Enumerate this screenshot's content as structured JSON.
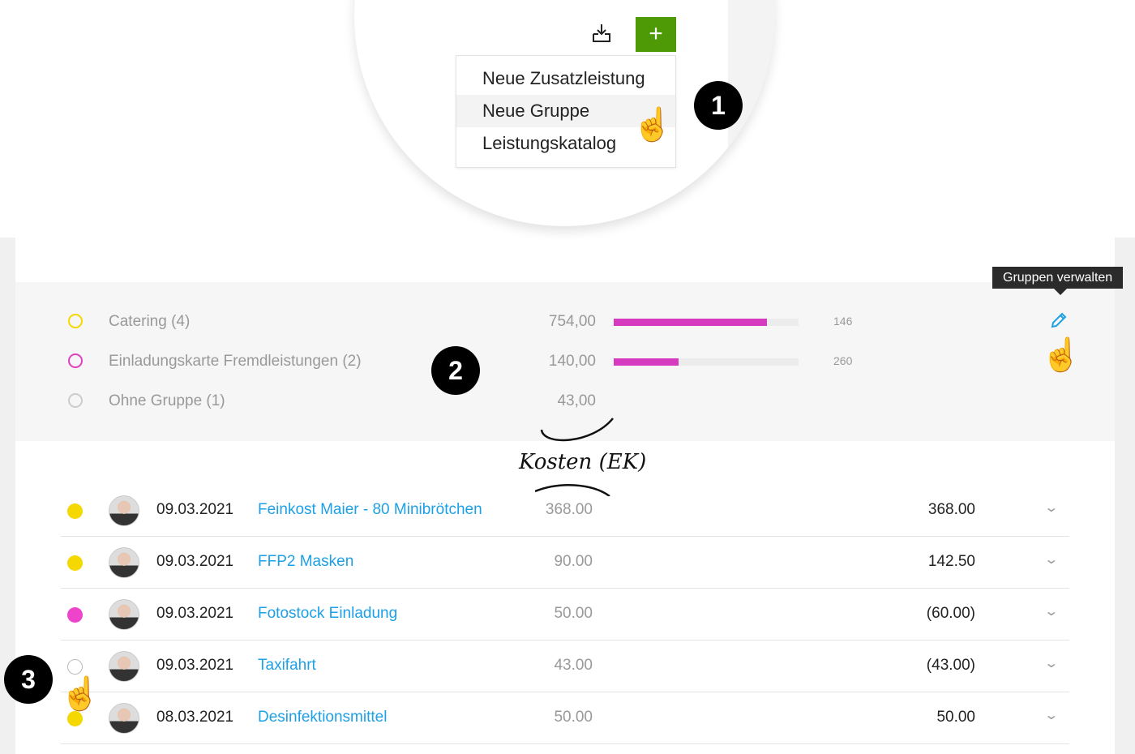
{
  "toolbar": {
    "add_label": "+",
    "download_icon": "download-tray-icon"
  },
  "menu": {
    "items": [
      "Neue Zusatzleistung",
      "Neue Gruppe",
      "Leistungskatalog"
    ],
    "hovered": 1
  },
  "badges": [
    "1",
    "2",
    "3"
  ],
  "tooltip": "Gruppen verwalten",
  "groups": [
    {
      "label": "Catering (4)",
      "amount": "754,00",
      "bar_percent": 83,
      "count": "146",
      "color": "#f5d800"
    },
    {
      "label": "Einladungskarte Fremdleistungen (2)",
      "amount": "140,00",
      "bar_percent": 35,
      "count": "260",
      "color": "#e040c0"
    },
    {
      "label": "Ohne Gruppe (1)",
      "amount": "43,00",
      "color": "#cccccc"
    }
  ],
  "annotation": "Kosten (EK)",
  "colors": {
    "accent": "#4e9a06",
    "link": "#1ea0e6",
    "bar": "#d63bbf"
  },
  "rows": [
    {
      "date": "09.03.2021",
      "title": "Feinkost Maier - 80 Minibrötchen",
      "cost": "368.00",
      "price": "368.00",
      "dot": "#f5d800"
    },
    {
      "date": "09.03.2021",
      "title": "FFP2 Masken",
      "cost": "90.00",
      "price": "142.50",
      "dot": "#f5d800"
    },
    {
      "date": "09.03.2021",
      "title": "Fotostock Einladung",
      "cost": "50.00",
      "price": "(60.00)",
      "dot": "#ee44cc"
    },
    {
      "date": "09.03.2021",
      "title": "Taxifahrt",
      "cost": "43.00",
      "price": "(43.00)",
      "dot": "empty"
    },
    {
      "date": "08.03.2021",
      "title": "Desinfektionsmittel",
      "cost": "50.00",
      "price": "50.00",
      "dot": "#f5d800"
    }
  ]
}
